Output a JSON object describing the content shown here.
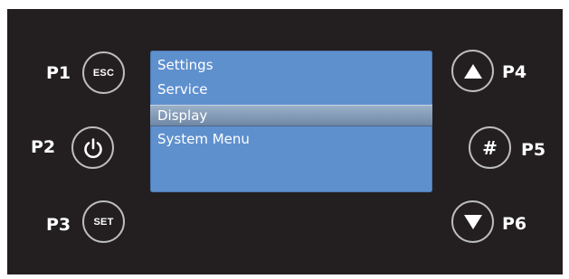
{
  "labels": {
    "p1": "P1",
    "p2": "P2",
    "p3": "P3",
    "p4": "P4",
    "p5": "P5",
    "p6": "P6"
  },
  "buttons": {
    "esc": "ESC",
    "set": "SET",
    "hash": "#",
    "power_icon": "power-icon",
    "up_icon": "triangle-up-icon",
    "down_icon": "triangle-down-icon"
  },
  "screen": {
    "menu": [
      "Settings",
      "Service",
      "Display",
      "System Menu"
    ],
    "selected": "Display"
  },
  "colors": {
    "panel": "#231f20",
    "screen": "#5f90ce",
    "highlight": "#8aa0bb",
    "button_border": "#bdbdbd"
  }
}
